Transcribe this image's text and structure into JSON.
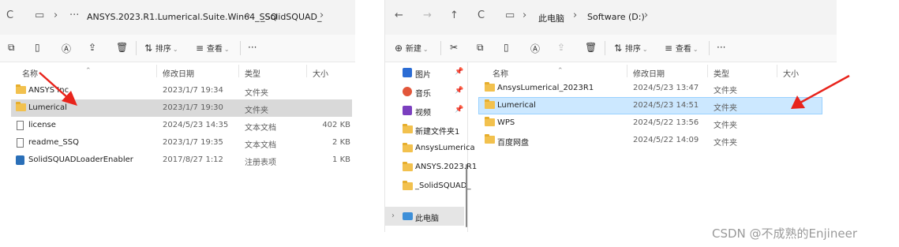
{
  "left": {
    "address": {
      "refresh_icon": "C",
      "pc_icon": "▭",
      "chevron": "›",
      "more": "···",
      "crumbs": [
        "ANSYS.2023.R1.Lumerical.Suite.Win64_SSQ",
        "_SolidSQUAD_"
      ]
    },
    "toolbar": {
      "sort": "排序",
      "view": "查看",
      "more": "···"
    },
    "columns": {
      "name": "名称",
      "date": "修改日期",
      "type": "类型",
      "size": "大小"
    },
    "rows": [
      {
        "name": "ANSYS Inc",
        "date": "2023/1/7 19:34",
        "type": "文件夹",
        "size": "",
        "icon": "folder-icon"
      },
      {
        "name": "Lumerical",
        "date": "2023/1/7 19:30",
        "type": "文件夹",
        "size": "",
        "icon": "folder-icon"
      },
      {
        "name": "license",
        "date": "2024/5/23 14:35",
        "type": "文本文档",
        "size": "402 KB",
        "icon": "text-file-icon"
      },
      {
        "name": "readme_SSQ",
        "date": "2023/1/7 19:35",
        "type": "文本文档",
        "size": "2 KB",
        "icon": "text-file-icon"
      },
      {
        "name": "SolidSQUADLoaderEnabler",
        "date": "2017/8/27 1:12",
        "type": "注册表项",
        "size": "1 KB",
        "icon": "registry-file-icon"
      }
    ]
  },
  "right": {
    "address": {
      "back": "←",
      "forward": "→",
      "up": "↑",
      "refresh": "C",
      "pc_icon": "▭",
      "chevron": "›",
      "crumbs": [
        "此电脑",
        "Software (D:)"
      ]
    },
    "toolbar": {
      "new": "新建",
      "sort": "排序",
      "view": "查看",
      "more": "···"
    },
    "columns": {
      "name": "名称",
      "date": "修改日期",
      "type": "类型",
      "size": "大小"
    },
    "rows": [
      {
        "name": "AnsysLumerical_2023R1",
        "date": "2024/5/23 13:47",
        "type": "文件夹"
      },
      {
        "name": "Lumerical",
        "date": "2024/5/23 14:51",
        "type": "文件夹"
      },
      {
        "name": "WPS",
        "date": "2024/5/22 13:56",
        "type": "文件夹"
      },
      {
        "name": "百度网盘",
        "date": "2024/5/22 14:09",
        "type": "文件夹"
      }
    ],
    "nav": [
      {
        "label": "图片",
        "icon": "pictures-icon",
        "pinned": true
      },
      {
        "label": "音乐",
        "icon": "music-icon",
        "pinned": true
      },
      {
        "label": "视频",
        "icon": "videos-icon",
        "pinned": true
      },
      {
        "label": "新建文件夹1",
        "icon": "folder-icon",
        "pinned": false
      },
      {
        "label": "AnsysLumerica",
        "icon": "folder-icon",
        "pinned": false
      },
      {
        "label": "ANSYS.2023.R1",
        "icon": "folder-icon",
        "pinned": false
      },
      {
        "label": "_SolidSQUAD_",
        "icon": "folder-icon",
        "pinned": false
      },
      {
        "label": "此电脑",
        "icon": "this-pc-icon",
        "pinned": false
      }
    ],
    "pin_glyph": "📌"
  },
  "colors": {
    "selected_blue": "#cce8ff",
    "selected_gray": "#d9d9d9",
    "arrow_red": "#e8241c",
    "folder_yellow": "#f2c14e"
  },
  "watermark": "CSDN @不成熟的Enjineer"
}
